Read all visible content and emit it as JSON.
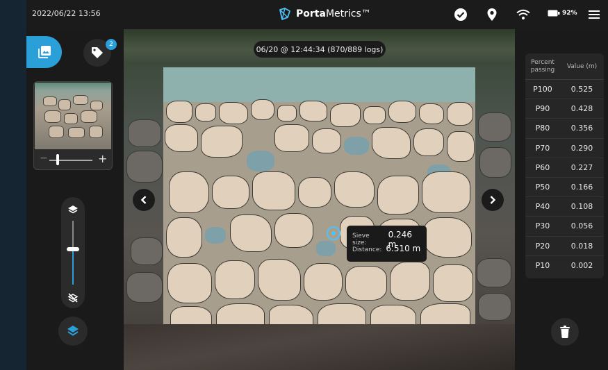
{
  "header": {
    "datetime": "2022/06/22 13:56",
    "brand_bold": "Porta",
    "brand_rest": "Metrics™",
    "battery": "92%"
  },
  "left_panel": {
    "tag_count": "2",
    "zoom_minus": "−",
    "zoom_plus": "+",
    "zoom_level": 0.2,
    "overlay_opacity": 0.55
  },
  "image": {
    "timestamp": "06/20 @ 12:44:34 (870/889 logs)",
    "tooltip": {
      "sieve_label": "Sieve size:",
      "sieve_value": "0.246 m",
      "distance_label": "Distance:",
      "distance_value": "6.510 m"
    }
  },
  "table": {
    "header_percent": "Percent passing",
    "header_value": "Value (m)",
    "rows": [
      {
        "p": "P100",
        "v": "0.525"
      },
      {
        "p": "P90",
        "v": "0.428"
      },
      {
        "p": "P80",
        "v": "0.356"
      },
      {
        "p": "P70",
        "v": "0.290"
      },
      {
        "p": "P60",
        "v": "0.227"
      },
      {
        "p": "P50",
        "v": "0.166"
      },
      {
        "p": "P40",
        "v": "0.108"
      },
      {
        "p": "P30",
        "v": "0.056"
      },
      {
        "p": "P20",
        "v": "0.018"
      },
      {
        "p": "P10",
        "v": "0.002"
      }
    ]
  },
  "icons": {
    "brand": "portametrics-logo-icon",
    "check": "check-circle-icon",
    "location": "location-pin-icon",
    "wifi": "wifi-icon",
    "battery": "battery-icon",
    "menu": "hamburger-menu-icon",
    "photo": "photo-gallery-icon",
    "tag": "tag-icon",
    "layers": "layers-icon",
    "trash": "trash-icon"
  },
  "colors": {
    "accent": "#2a9fd8",
    "marker": "#4fc3f7"
  }
}
